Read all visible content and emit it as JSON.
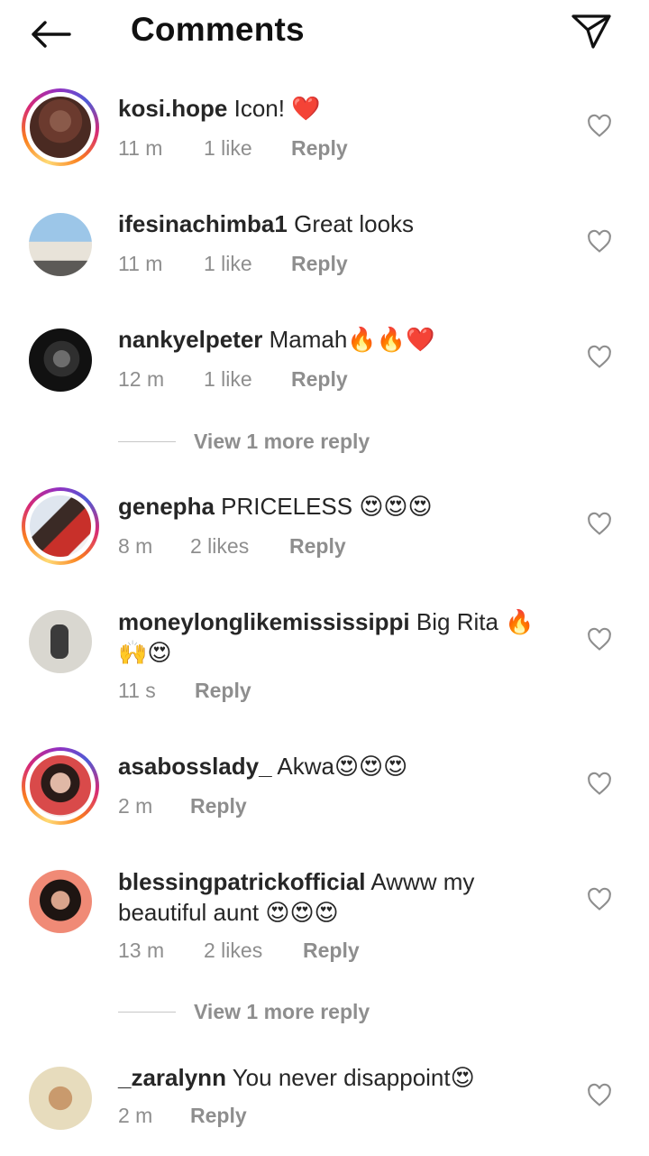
{
  "header": {
    "title": "Comments",
    "back_icon": "arrow-left-icon",
    "share_icon": "paper-plane-icon"
  },
  "colors": {
    "text": "#262626",
    "muted": "#8e8e8e",
    "story_ring": [
      "#feda75",
      "#fa7e1e",
      "#d62976",
      "#962fbf",
      "#4f5bd5"
    ]
  },
  "comments": [
    {
      "username": "kosi.hope",
      "text": "Icon! ❤️",
      "time": "11 m",
      "likes": "1 like",
      "reply": "Reply",
      "story_ring": true
    },
    {
      "username": "ifesinachimba1",
      "text": "Great looks",
      "time": "11 m",
      "likes": "1 like",
      "reply": "Reply",
      "story_ring": false
    },
    {
      "username": "nankyelpeter",
      "text": "Mamah🔥🔥❤️",
      "time": "12 m",
      "likes": "1 like",
      "reply": "Reply",
      "story_ring": false,
      "view_more": "View 1 more reply"
    },
    {
      "username": "genepha",
      "text": "PRICELESS 😍😍😍",
      "time": "8 m",
      "likes": "2 likes",
      "reply": "Reply",
      "story_ring": true
    },
    {
      "username": "moneylonglikemississippi",
      "text": "Big Rita 🔥🙌😍",
      "time": "11 s",
      "likes": "",
      "reply": "Reply",
      "story_ring": false
    },
    {
      "username": "asabosslady_",
      "text": "Akwa😍😍😍",
      "time": "2 m",
      "likes": "",
      "reply": "Reply",
      "story_ring": true
    },
    {
      "username": "blessingpatrickofficial",
      "text": "Awww my beautiful aunt 😍😍😍",
      "time": "13 m",
      "likes": "2 likes",
      "reply": "Reply",
      "story_ring": false,
      "view_more": "View 1 more reply"
    },
    {
      "username": "_zaralynn",
      "text": "You never disappoint😍",
      "time": "2 m",
      "likes": "",
      "reply": "Reply",
      "story_ring": false
    }
  ]
}
